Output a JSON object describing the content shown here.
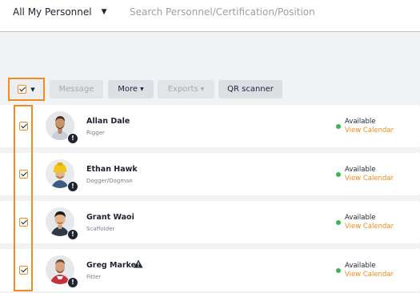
{
  "header": {
    "scope_label": "All My Personnel",
    "search_placeholder": "Search Personnel/Certification/Position"
  },
  "toolbar": {
    "message_label": "Message",
    "more_label": "More",
    "exports_label": "Exports",
    "qr_label": "QR scanner"
  },
  "personnel": [
    {
      "name": "Allan Dale",
      "role": "Rigger",
      "status": "Available",
      "calendar_link": "View Calendar",
      "selected": true,
      "warning": false
    },
    {
      "name": "Ethan Hawk",
      "role": "Dogger/Dogman",
      "status": "Available",
      "calendar_link": "View Calendar",
      "selected": true,
      "warning": false
    },
    {
      "name": "Grant Waoi",
      "role": "Scaffolder",
      "status": "Available",
      "calendar_link": "View Calendar",
      "selected": true,
      "warning": false
    },
    {
      "name": "Greg Marker",
      "role": "Fitter",
      "status": "Available",
      "calendar_link": "View Calendar",
      "selected": true,
      "warning": true
    }
  ],
  "icons": {
    "alert_badge": "!",
    "warning": "warning-triangle-icon",
    "checkbox": "checkbox-checked-icon",
    "caret": "caret-down-icon"
  },
  "colors": {
    "accent": "#f28c1e",
    "available": "#3cb54a",
    "badge": "#1f2430"
  }
}
